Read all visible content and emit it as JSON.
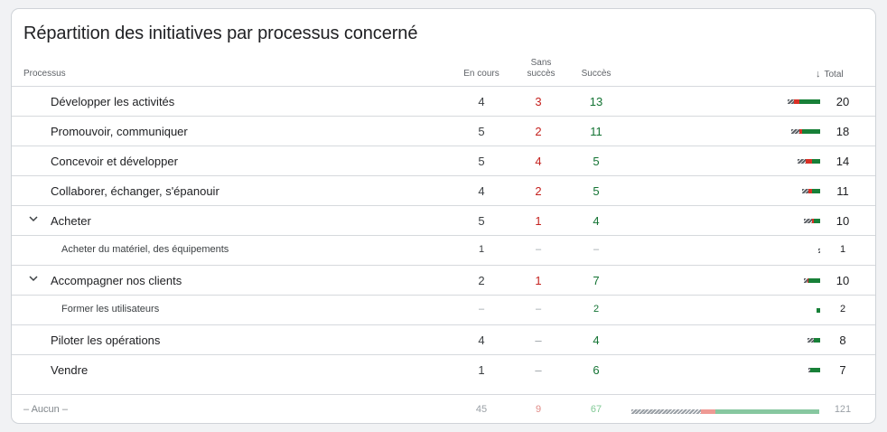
{
  "title": "Répartition des initiatives par processus concerné",
  "columns": {
    "process": "Processus",
    "in_progress": "En cours",
    "failure_line1": "Sans",
    "failure_line2": "succès",
    "success": "Succès",
    "total": "Total",
    "sort_icon": "arrow-down-icon"
  },
  "rows": [
    {
      "label": "Développer les activités",
      "level": 0,
      "expandable": false,
      "in_progress": "4",
      "failure": "3",
      "success": "13",
      "total": "20",
      "ip": 4,
      "fail": 3,
      "ok": 13
    },
    {
      "label": "Promouvoir, communiquer",
      "level": 0,
      "expandable": false,
      "in_progress": "5",
      "failure": "2",
      "success": "11",
      "total": "18",
      "ip": 5,
      "fail": 2,
      "ok": 11
    },
    {
      "label": "Concevoir et développer",
      "level": 0,
      "expandable": false,
      "in_progress": "5",
      "failure": "4",
      "success": "5",
      "total": "14",
      "ip": 5,
      "fail": 4,
      "ok": 5
    },
    {
      "label": "Collaborer, échanger, s'épanouir",
      "level": 0,
      "expandable": false,
      "in_progress": "4",
      "failure": "2",
      "success": "5",
      "total": "11",
      "ip": 4,
      "fail": 2,
      "ok": 5
    },
    {
      "label": "Acheter",
      "level": 0,
      "expandable": true,
      "in_progress": "5",
      "failure": "1",
      "success": "4",
      "total": "10",
      "ip": 5,
      "fail": 1,
      "ok": 4
    },
    {
      "label": "Acheter du matériel, des équipements",
      "level": 1,
      "expandable": false,
      "in_progress": "1",
      "failure": "–",
      "success": "–",
      "total": "1",
      "ip": 1,
      "fail": 0,
      "ok": 0
    },
    {
      "label": "Accompagner nos clients",
      "level": 0,
      "expandable": true,
      "in_progress": "2",
      "failure": "1",
      "success": "7",
      "total": "10",
      "ip": 2,
      "fail": 1,
      "ok": 7
    },
    {
      "label": "Former les utilisateurs",
      "level": 1,
      "expandable": false,
      "in_progress": "–",
      "failure": "–",
      "success": "2",
      "total": "2",
      "ip": 0,
      "fail": 0,
      "ok": 2
    },
    {
      "label": "Piloter les opérations",
      "level": 0,
      "expandable": false,
      "in_progress": "4",
      "failure": "–",
      "success": "4",
      "total": "8",
      "ip": 4,
      "fail": 0,
      "ok": 4
    },
    {
      "label": "Vendre",
      "level": 0,
      "expandable": false,
      "in_progress": "1",
      "failure": "–",
      "success": "6",
      "total": "7",
      "ip": 1,
      "fail": 0,
      "ok": 6
    }
  ],
  "footer": {
    "label": "– Aucun –",
    "in_progress": "45",
    "failure": "9",
    "success": "67",
    "total": "121",
    "ip": 45,
    "fail": 9,
    "ok": 67
  },
  "colors": {
    "failure": "#c5221f",
    "success": "#137333",
    "bar_failure": "#d93025",
    "bar_success": "#188038"
  }
}
